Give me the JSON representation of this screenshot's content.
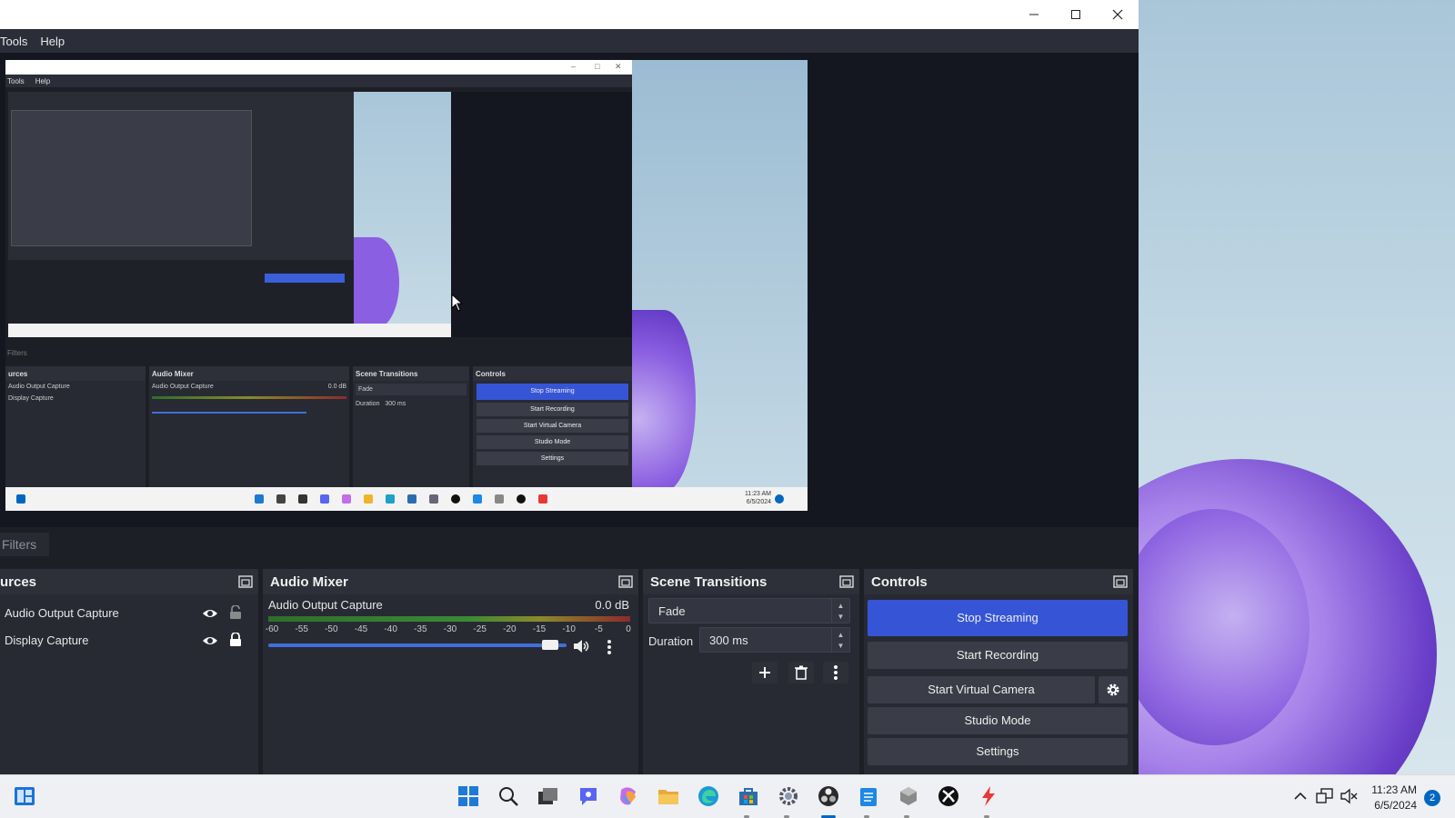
{
  "window": {
    "controls": [
      "minimize",
      "maximize",
      "close"
    ]
  },
  "menu": {
    "items": [
      "Tools",
      "Help"
    ]
  },
  "preview": {
    "captured_menu": [
      "Tools",
      "Help"
    ],
    "captured_filters": "Filters",
    "captured_docks": {
      "sources": "urces",
      "audio_mixer": "Audio Mixer",
      "scene_transitions": "Scene Transitions",
      "controls": "Controls",
      "source_items": [
        "Audio Output Capture",
        "Display Capture"
      ],
      "mixer_label": "Audio Output Capture",
      "mixer_db": "0.0 dB",
      "transition": "Fade",
      "duration_label": "Duration",
      "duration": "300 ms",
      "buttons": [
        "Stop Streaming",
        "Start Recording",
        "Start Virtual Camera",
        "Studio Mode",
        "Settings"
      ]
    },
    "captured_clock": {
      "time": "11:23 AM",
      "date": "6/5/2024"
    }
  },
  "filters": {
    "label": "Filters"
  },
  "sources": {
    "title": "urces",
    "items": [
      {
        "label": "Audio Output Capture",
        "visible": true,
        "locked": false
      },
      {
        "label": "Display Capture",
        "visible": true,
        "locked": true
      }
    ]
  },
  "audio_mixer": {
    "title": "Audio Mixer",
    "channel": "Audio Output Capture",
    "level": "0.0 dB",
    "ticks": [
      "-60",
      "-55",
      "-50",
      "-45",
      "-40",
      "-35",
      "-30",
      "-25",
      "-20",
      "-15",
      "-10",
      "-5",
      "0"
    ],
    "volume_fraction": 0.97
  },
  "scene_transitions": {
    "title": "Scene Transitions",
    "transition": "Fade",
    "duration_label": "Duration",
    "duration": "300 ms"
  },
  "controls": {
    "title": "Controls",
    "stop_streaming": "Stop Streaming",
    "start_recording": "Start Recording",
    "start_virtual_camera": "Start Virtual Camera",
    "studio_mode": "Studio Mode",
    "settings": "Settings"
  },
  "taskbar": {
    "icons": [
      "widgets-icon",
      "start-icon",
      "search-icon",
      "task-view-icon",
      "chat-icon",
      "copilot-icon",
      "file-explorer-icon",
      "edge-icon",
      "store-icon",
      "settings-icon",
      "obs-icon",
      "notepad-icon",
      "virtualbox-icon",
      "xbox-icon",
      "app-icon"
    ],
    "clock": {
      "time": "11:23 AM",
      "date": "6/5/2024"
    },
    "notifications": "2"
  },
  "colors": {
    "accent": "#3655d6",
    "dock_bg": "#272a33",
    "window_bg": "#1d1f26"
  }
}
